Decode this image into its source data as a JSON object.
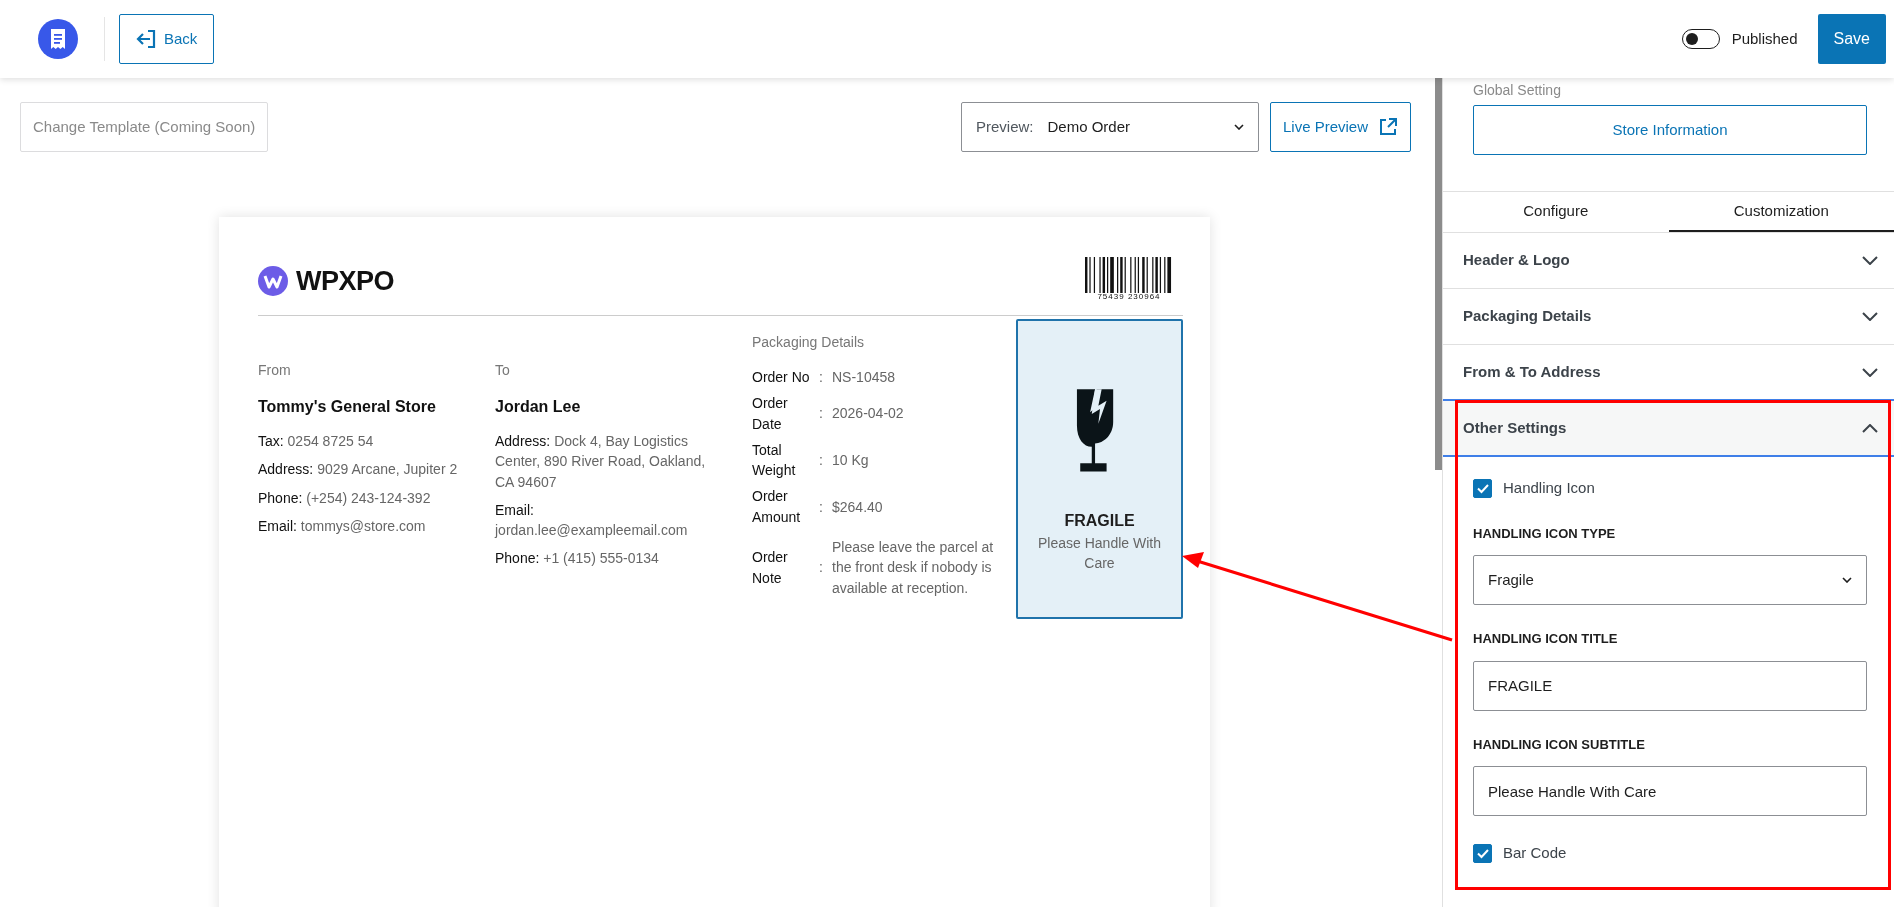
{
  "topbar": {
    "back_label": "Back",
    "published": {
      "label": "Published",
      "on": false
    },
    "save_label": "Save"
  },
  "toolbar": {
    "change_template": "Change Template (Coming Soon)",
    "preview_label": "Preview:",
    "preview_value": "Demo Order",
    "live_preview": "Live Preview"
  },
  "label": {
    "brand": "WPXPO",
    "barcode_number": "75439  230964",
    "from": {
      "heading": "From",
      "name": "Tommy's General Store",
      "lines": [
        {
          "key": "Tax:",
          "value": "0254 8725 54"
        },
        {
          "key": "Address:",
          "value": "9029 Arcane, Jupiter 2"
        },
        {
          "key": "Phone:",
          "value": "(+254) 243-124-392"
        },
        {
          "key": "Email:",
          "value": "tommys@store.com"
        }
      ]
    },
    "to": {
      "heading": "To",
      "name": "Jordan Lee",
      "lines": [
        {
          "key": "Address:",
          "value": "Dock 4, Bay Logistics Center, 890 River Road, Oakland, CA 94607"
        },
        {
          "key": "Email:",
          "value": "jordan.lee@exampleemail.com"
        },
        {
          "key": "Phone:",
          "value": "+1 (415) 555-0134"
        }
      ]
    },
    "packaging": {
      "heading": "Packaging Details",
      "rows": [
        {
          "key": "Order No",
          "sep": ":",
          "value": "NS-10458"
        },
        {
          "key": "Order Date",
          "sep": ":",
          "value": "2026-04-02"
        },
        {
          "key": "Total Weight",
          "sep": ":",
          "value": "10 Kg"
        },
        {
          "key": "Order Amount",
          "sep": ":",
          "value": "$264.40"
        },
        {
          "key": "Order Note",
          "sep": ":",
          "value": "Please leave the parcel at the front desk if nobody is available at reception."
        }
      ]
    },
    "handling": {
      "title": "FRAGILE",
      "subtitle": "Please Handle With Care"
    }
  },
  "sidebar": {
    "global_setting": "Global Setting",
    "store_button": "Store Information",
    "tabs": [
      {
        "label": "Configure",
        "selected": false
      },
      {
        "label": "Customization",
        "selected": true
      }
    ],
    "sections": [
      {
        "title": "Header & Logo",
        "expanded": false
      },
      {
        "title": "Packaging Details",
        "expanded": false
      },
      {
        "title": "From & To Address",
        "expanded": false
      },
      {
        "title": "Other Settings",
        "expanded": true
      }
    ],
    "other_settings": [
      {
        "kind": "checkbox",
        "label": "Handling Icon",
        "checked": true
      },
      {
        "kind": "select",
        "label": "HANDLING ICON TYPE",
        "value": "Fragile"
      },
      {
        "kind": "text",
        "label": "HANDLING ICON TITLE",
        "value": "FRAGILE"
      },
      {
        "kind": "text",
        "label": "HANDLING ICON SUBTITLE",
        "value": "Please Handle With Care"
      },
      {
        "kind": "checkbox",
        "label": "Bar Code",
        "checked": true
      }
    ]
  }
}
